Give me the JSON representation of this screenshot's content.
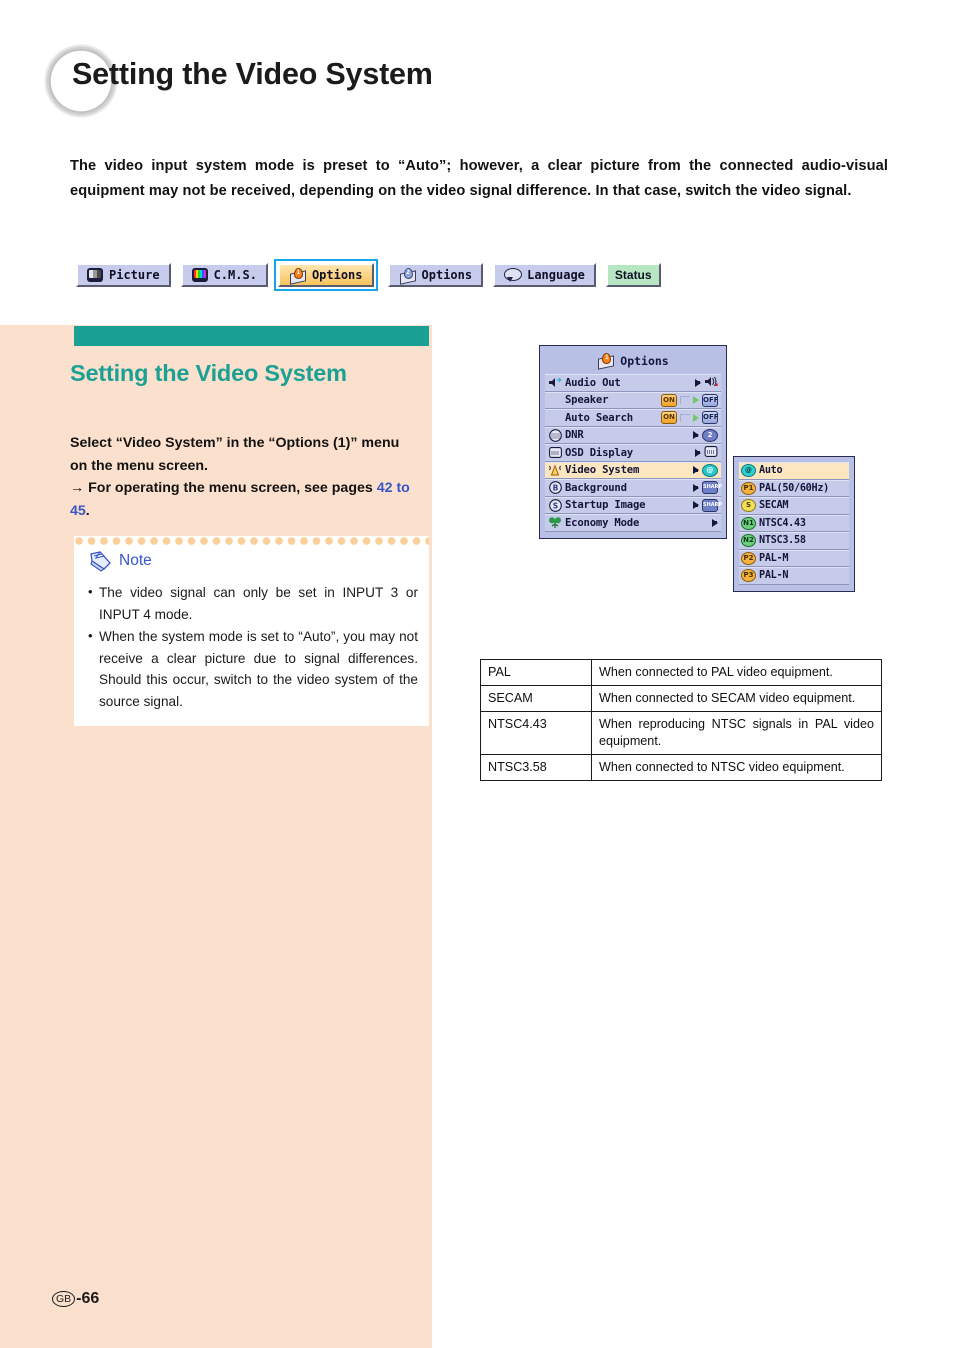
{
  "page": {
    "title": "Setting the Video System",
    "footer_mark": "GB",
    "footer_page": "-66"
  },
  "intro": {
    "paragraph": "The video input system mode is preset to “Auto”; however, a clear picture from the connected audio-visual equipment may not be received, depending on the video signal difference. In that case, switch the video signal."
  },
  "tabs": [
    {
      "label": "Picture",
      "icon": "picture-icon",
      "selected": false,
      "outlined": false
    },
    {
      "label": "C.M.S.",
      "icon": "cms-icon",
      "selected": false,
      "outlined": false
    },
    {
      "label": "Options",
      "icon": "options1-icon",
      "selected": true,
      "outlined": true
    },
    {
      "label": "Options",
      "icon": "options2-icon",
      "selected": false,
      "outlined": false
    },
    {
      "label": "Language",
      "icon": "language-icon",
      "selected": false,
      "outlined": false
    },
    {
      "label": "Status",
      "icon": "status-icon",
      "selected": false,
      "outlined": false
    }
  ],
  "section": {
    "heading": "Setting the Video System",
    "instruction_line1": "Select “Video System” in the “Options (1)” menu on the menu screen.",
    "instruction_arrow": "→",
    "instruction_line2_pre": "For operating the menu screen, see pages ",
    "instruction_pages": "42 to 45",
    "instruction_line2_post": "."
  },
  "note": {
    "label": "Note",
    "items": [
      "The video signal can only be set in INPUT 3 or INPUT 4 mode.",
      "When the system mode is set to “Auto”, you may not receive a clear picture due to signal differences. Should this occur, switch to the video system of the source signal."
    ]
  },
  "osd_menu": {
    "title": "Options",
    "title_icon": "options-cube-icon",
    "rows": [
      {
        "label": "Audio Out",
        "icon": "speaker-arrow-icon",
        "right": "arrow+speaker",
        "value": "",
        "highlight": false
      },
      {
        "label": "Speaker",
        "icon": "",
        "right": "onoff",
        "on": "ON",
        "off": "OFF",
        "highlight": false
      },
      {
        "label": "Auto Search",
        "icon": "",
        "right": "onoff",
        "on": "ON",
        "off": "OFF",
        "highlight": false
      },
      {
        "label": "DNR",
        "icon": "dnr-icon",
        "right": "arrow+badge",
        "value": "2",
        "highlight": false
      },
      {
        "label": "OSD Display",
        "icon": "osd-icon",
        "right": "arrow+badge",
        "value": "",
        "highlight": false
      },
      {
        "label": "Video System",
        "icon": "antenna-icon",
        "right": "arrow+badge",
        "value": "@",
        "highlight": true
      },
      {
        "label": "Background",
        "icon": "b-icon",
        "right": "arrow+badge",
        "value": "SHARP",
        "highlight": false
      },
      {
        "label": "Startup Image",
        "icon": "s-icon",
        "right": "arrow+badge",
        "value": "SHARP",
        "highlight": false
      },
      {
        "label": "Economy Mode",
        "icon": "tree-icon",
        "right": "arrow",
        "value": "",
        "highlight": false
      }
    ]
  },
  "osd_submenu": {
    "items": [
      {
        "badge": "@",
        "badge_class": "sb-auto",
        "label": "Auto",
        "highlight": true
      },
      {
        "badge": "P1",
        "badge_class": "sb-p",
        "label": "PAL(50/60Hz)",
        "highlight": false
      },
      {
        "badge": "S",
        "badge_class": "sb-s",
        "label": "SECAM",
        "highlight": false
      },
      {
        "badge": "N1",
        "badge_class": "sb-n",
        "label": "NTSC4.43",
        "highlight": false
      },
      {
        "badge": "N2",
        "badge_class": "sb-n",
        "label": "NTSC3.58",
        "highlight": false
      },
      {
        "badge": "P2",
        "badge_class": "sb-p",
        "label": "PAL-M",
        "highlight": false
      },
      {
        "badge": "P3",
        "badge_class": "sb-p",
        "label": "PAL-N",
        "highlight": false
      }
    ]
  },
  "desc_table": {
    "rows": [
      {
        "term": "PAL",
        "desc": "When connected to PAL video equipment."
      },
      {
        "term": "SECAM",
        "desc": "When connected to SECAM video equipment."
      },
      {
        "term": "NTSC4.43",
        "desc": "When reproducing NTSC signals in PAL video equipment."
      },
      {
        "term": "NTSC3.58",
        "desc": "When connected to NTSC video equipment."
      }
    ]
  },
  "colors": {
    "teal": "#1ba193",
    "peach": "#fbe0cd",
    "link_blue": "#3556c8",
    "osd_blue": "#b9c0e6",
    "osd_highlight": "#fbe6c0",
    "tab_selected": "#f7c45c",
    "outline_blue": "#16a6e8"
  }
}
